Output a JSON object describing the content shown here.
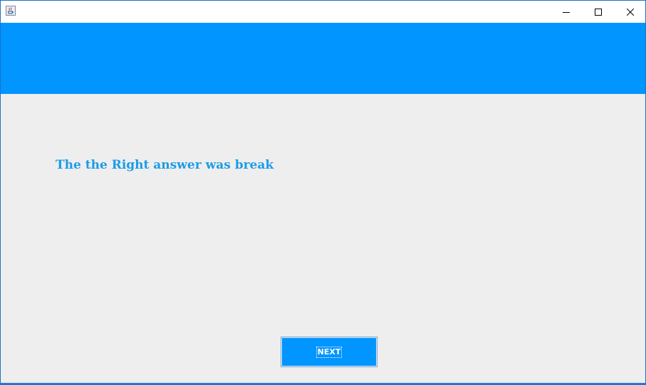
{
  "window": {
    "title": "",
    "icons": {
      "app": "java-app-icon",
      "minimize": "minimize-icon",
      "maximize": "maximize-icon",
      "close": "close-icon"
    }
  },
  "colors": {
    "banner": "#0095ff",
    "message_text": "#1b9ce8",
    "button_bg": "#0095ff",
    "content_bg": "#eeeeee"
  },
  "main": {
    "message": "The the Right answer was break",
    "next_label": "NEXT"
  }
}
